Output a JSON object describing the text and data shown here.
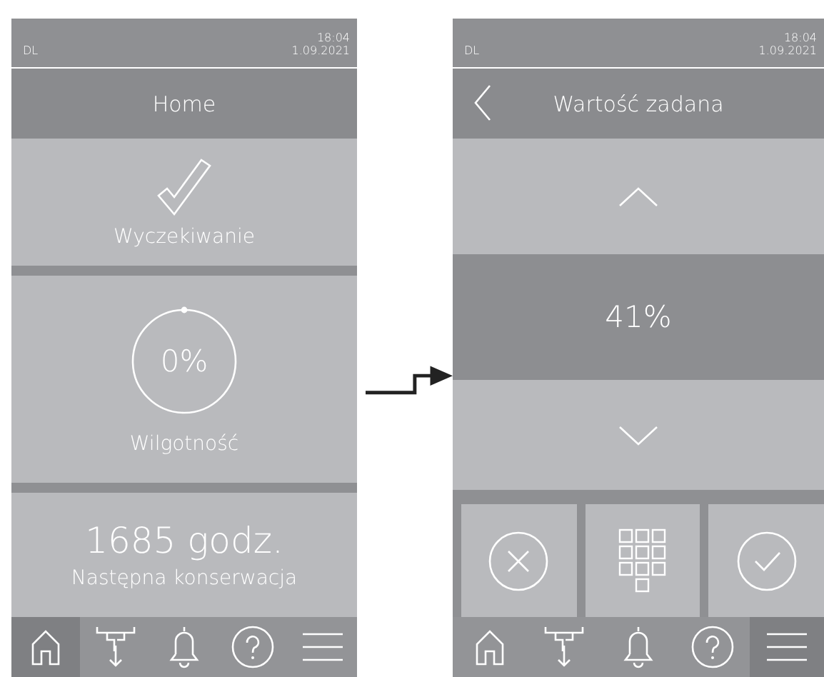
{
  "screens": [
    {
      "status": {
        "user": "DL",
        "time": "18:04",
        "date": "1.09.2021"
      },
      "kind": "overview",
      "title": "Home",
      "cards": [
        {
          "kind": "status",
          "label": "Wyczekiwanie"
        },
        {
          "kind": "gauge",
          "value": "0%",
          "label": "Wilgotność"
        },
        {
          "kind": "counter",
          "value": "1685 godz.",
          "label": "Następna konserwacja"
        }
      ],
      "nav": [
        {
          "kind": "home",
          "selected": true
        },
        {
          "kind": "drain",
          "selected": false
        },
        {
          "kind": "bell",
          "selected": false
        },
        {
          "kind": "help",
          "selected": false
        },
        {
          "kind": "menu",
          "selected": false
        }
      ]
    },
    {
      "status": {
        "user": "DL",
        "time": "18:04",
        "date": "1.09.2021"
      },
      "kind": "editor",
      "title": "Wartość zadana",
      "setpoint": {
        "value": "41%"
      },
      "actions": [
        {
          "kind": "cancel"
        },
        {
          "kind": "keypad"
        },
        {
          "kind": "confirm"
        }
      ],
      "nav": [
        {
          "kind": "home",
          "selected": false
        },
        {
          "kind": "drain",
          "selected": false
        },
        {
          "kind": "bell",
          "selected": false
        },
        {
          "kind": "help",
          "selected": false
        },
        {
          "kind": "menu",
          "selected": true
        }
      ]
    }
  ]
}
